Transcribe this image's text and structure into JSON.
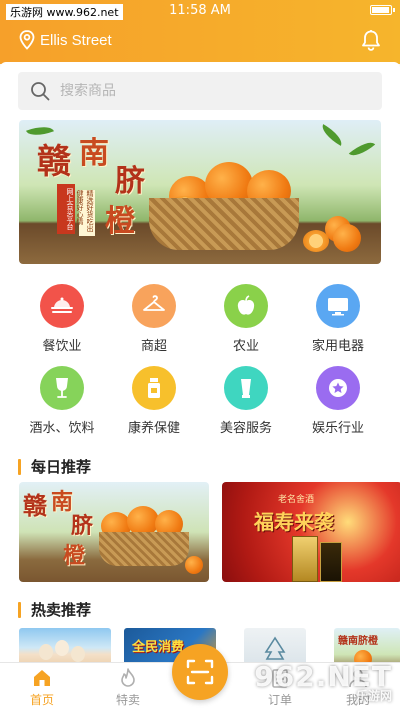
{
  "status_bar": {
    "carrier": "乐游网 www.962.net",
    "time": "11:58 AM"
  },
  "header": {
    "location": "Ellis Street",
    "location_icon": "location-pin-icon",
    "bell_icon": "bell-icon",
    "accent": "#f6a323"
  },
  "search": {
    "placeholder": "搜索商品"
  },
  "banner": {
    "title_chars": [
      "赣",
      "南",
      "脐",
      "橙"
    ],
    "tag_a": "网上合买平台",
    "tag_b": "精选好货吃出健康好心情"
  },
  "categories": [
    {
      "label": "餐饮业",
      "icon": "dish-icon",
      "color": "#f2534a"
    },
    {
      "label": "商超",
      "icon": "hanger-icon",
      "color": "#f8a35c"
    },
    {
      "label": "农业",
      "icon": "apple-icon",
      "color": "#8ad14a"
    },
    {
      "label": "家用电器",
      "icon": "monitor-icon",
      "color": "#5aa7f2"
    },
    {
      "label": "酒水、饮料",
      "icon": "wineglass-icon",
      "color": "#86d35a"
    },
    {
      "label": "康养保健",
      "icon": "medicine-bottle-icon",
      "color": "#f7c02c"
    },
    {
      "label": "美容服务",
      "icon": "cosmetics-icon",
      "color": "#3fd6c0"
    },
    {
      "label": "娱乐行业",
      "icon": "star-badge-icon",
      "color": "#9a6cf0"
    }
  ],
  "sections": {
    "daily": "每日推荐",
    "hot": "热卖推荐"
  },
  "promo": {
    "left_chars": [
      "赣",
      "南",
      "脐",
      "橙"
    ],
    "right_title": "福寿来袭",
    "right_brand": "老名舍酒"
  },
  "hot_items": [
    "全民消费",
    "赣南脐橙"
  ],
  "tabs": [
    {
      "label": "首页",
      "icon": "home-icon",
      "active": true
    },
    {
      "label": "特卖",
      "icon": "flame-icon",
      "active": false
    },
    {
      "label": "",
      "icon": "scan-icon",
      "active": false
    },
    {
      "label": "订单",
      "icon": "order-icon",
      "active": false
    },
    {
      "label": "我的",
      "icon": "user-icon",
      "active": false
    }
  ],
  "watermark": {
    "big": "962.NET",
    "small": "乐游网"
  }
}
